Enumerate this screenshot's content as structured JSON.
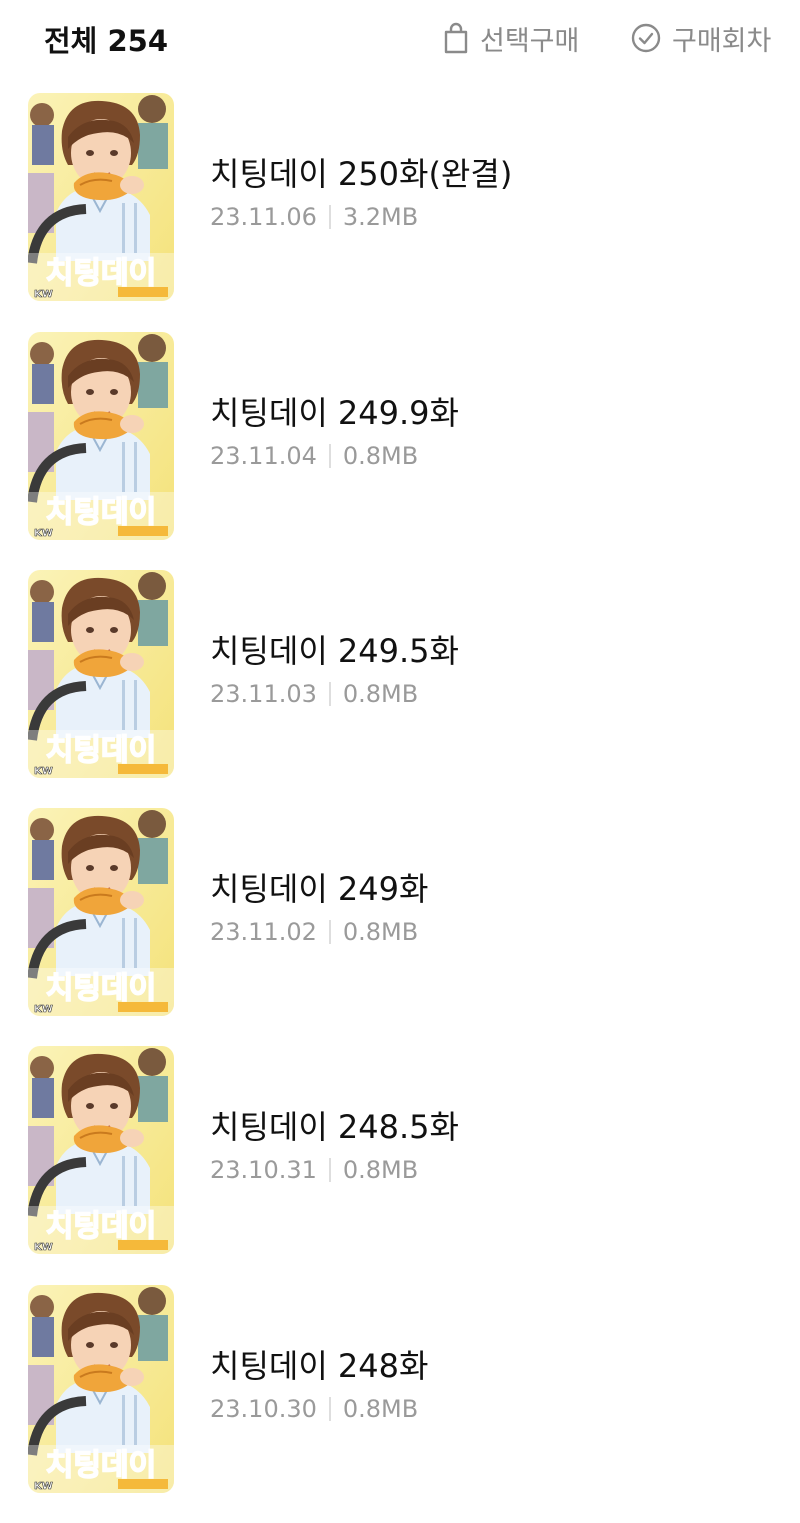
{
  "header": {
    "total_label": "전체 254",
    "select_purchase_label": "선택구매",
    "purchased_label": "구매회차",
    "select_purchase_icon": "shopping-bag-icon",
    "purchased_icon": "check-circle-icon"
  },
  "episodes": [
    {
      "title": "치팅데이 250화(완결)",
      "date": "23.11.06",
      "size": "3.2MB"
    },
    {
      "title": "치팅데이 249.9화",
      "date": "23.11.04",
      "size": "0.8MB"
    },
    {
      "title": "치팅데이 249.5화",
      "date": "23.11.03",
      "size": "0.8MB"
    },
    {
      "title": "치팅데이 249화",
      "date": "23.11.02",
      "size": "0.8MB"
    },
    {
      "title": "치팅데이 248.5화",
      "date": "23.10.31",
      "size": "0.8MB"
    },
    {
      "title": "치팅데이 248화",
      "date": "23.10.30",
      "size": "0.8MB"
    }
  ],
  "thumbnail": {
    "logo_text": "치팅데이",
    "badge_text": "KW"
  },
  "colors": {
    "title_text": "#111111",
    "meta_text": "#9a9a9a",
    "header_button_text": "#8a8a8a",
    "thumbnail_logo_pink": "#e83a7a",
    "thumbnail_bg_yellow": "#f4e27a"
  }
}
